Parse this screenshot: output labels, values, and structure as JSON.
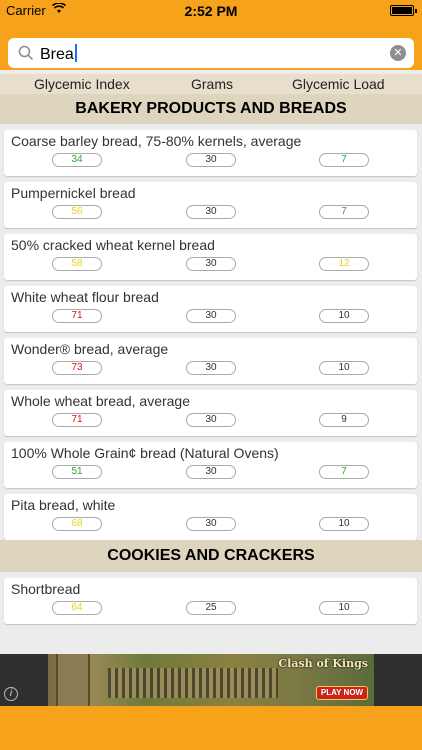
{
  "status_bar": {
    "carrier": "Carrier",
    "wifi_icon": "wifi-icon",
    "time": "2:52 PM",
    "battery_icon": "battery-icon"
  },
  "search": {
    "value": "Brea",
    "search_icon": "search-icon",
    "clear_icon": "clear-icon"
  },
  "columns": {
    "glycemic_index": "Glycemic Index",
    "grams": "Grams",
    "glycemic_load": "Glycemic Load"
  },
  "colors": {
    "accent": "#f7a21b",
    "section_bg": "#ddd5bd",
    "low": "#2fa52f",
    "medium": "#e8d21a",
    "high": "#d31a1a",
    "neutral": "#333333"
  },
  "sections": [
    {
      "title": "BAKERY PRODUCTS AND BREADS",
      "items": [
        {
          "name": "Coarse barley bread, 75-80% kernels, average",
          "gi": "34",
          "gi_level": "low",
          "grams": "30",
          "gl": "7",
          "gl_level": "low"
        },
        {
          "name": "Pumpernickel bread",
          "gi": "56",
          "gi_level": "medium",
          "grams": "30",
          "gl": "7",
          "gl_level": "low"
        },
        {
          "name": "50% cracked wheat kernel bread",
          "gi": "58",
          "gi_level": "medium",
          "grams": "30",
          "gl": "12",
          "gl_level": "medium"
        },
        {
          "name": "White wheat flour bread",
          "gi": "71",
          "gi_level": "high",
          "grams": "30",
          "gl": "10",
          "gl_level": "neutral"
        },
        {
          "name": "Wonder® bread, average",
          "gi": "73",
          "gi_level": "high",
          "grams": "30",
          "gl": "10",
          "gl_level": "neutral"
        },
        {
          "name": "Whole wheat bread, average",
          "gi": "71",
          "gi_level": "high",
          "grams": "30",
          "gl": "9",
          "gl_level": "neutral"
        },
        {
          "name": "100% Whole Grain¢ bread (Natural Ovens)",
          "gi": "51",
          "gi_level": "low",
          "grams": "30",
          "gl": "7",
          "gl_level": "low"
        },
        {
          "name": "Pita bread, white",
          "gi": "68",
          "gi_level": "medium",
          "grams": "30",
          "gl": "10",
          "gl_level": "neutral"
        }
      ]
    },
    {
      "title": "COOKIES AND CRACKERS",
      "items": [
        {
          "name": "Shortbread",
          "gi": "64",
          "gi_level": "medium",
          "grams": "25",
          "gl": "10",
          "gl_level": "neutral"
        }
      ]
    }
  ],
  "ad": {
    "logo": "Clash of Kings",
    "play_label": "PLAY NOW",
    "info_icon": "info-icon"
  }
}
